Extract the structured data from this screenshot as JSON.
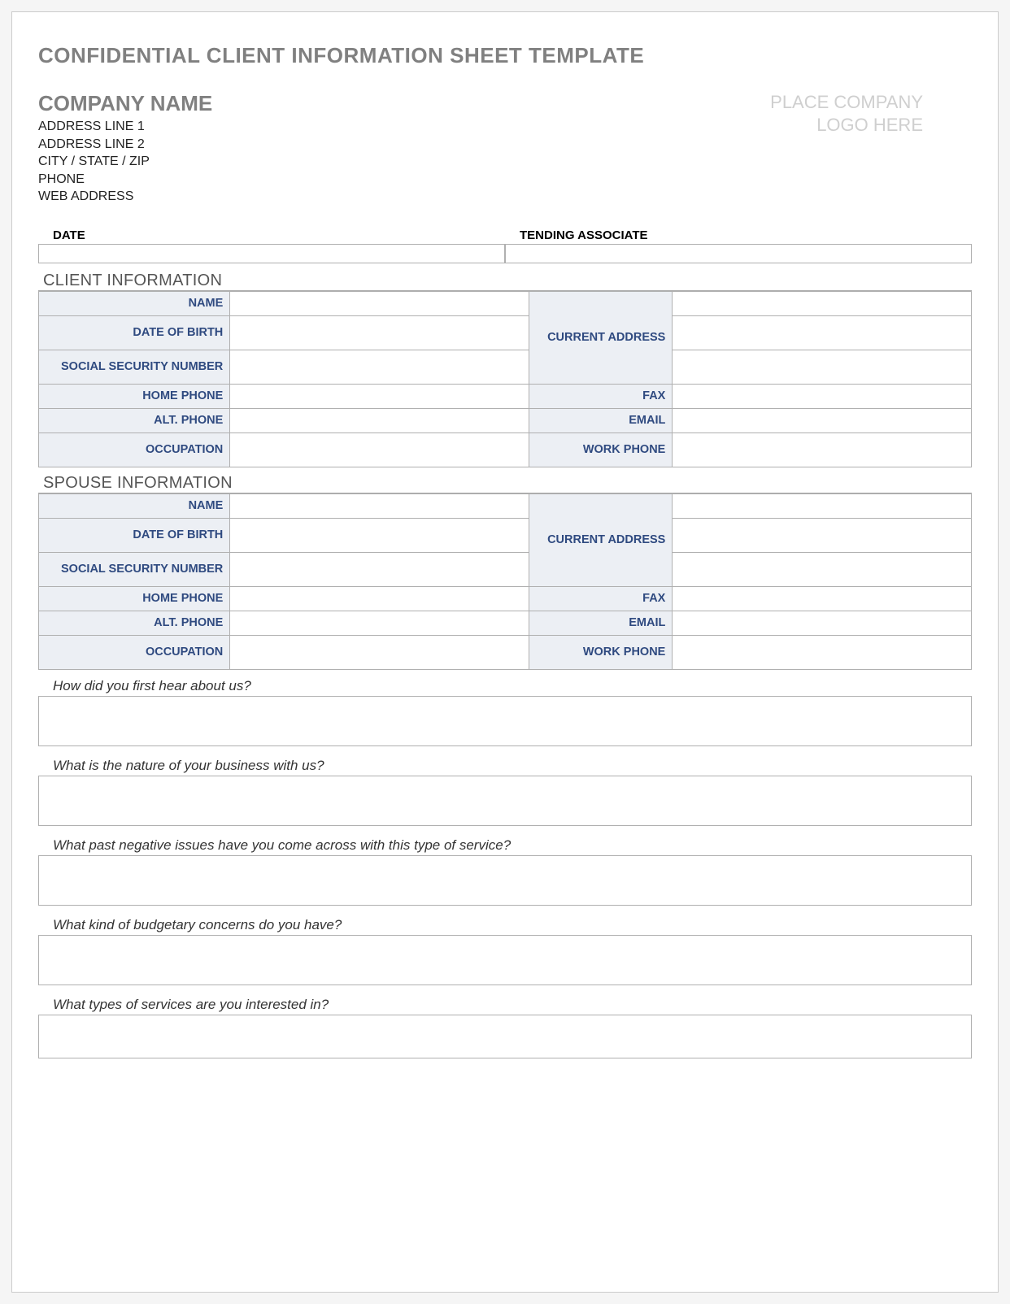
{
  "doc_title": "CONFIDENTIAL CLIENT INFORMATION SHEET TEMPLATE",
  "company": {
    "name": "COMPANY NAME",
    "addr1": "ADDRESS LINE 1",
    "addr2": "ADDRESS LINE 2",
    "city_state_zip": "CITY / STATE / ZIP",
    "phone": "PHONE",
    "web": "WEB ADDRESS"
  },
  "logo_placeholder": {
    "line1": "PLACE COMPANY",
    "line2": "LOGO HERE"
  },
  "top_fields": {
    "date_label": "DATE",
    "associate_label": "TENDING ASSOCIATE"
  },
  "sections": {
    "client_title": "CLIENT INFORMATION",
    "spouse_title": "SPOUSE INFORMATION"
  },
  "labels": {
    "name": "NAME",
    "dob": "DATE OF BIRTH",
    "ssn": "SOCIAL SECURITY NUMBER",
    "home_phone": "HOME PHONE",
    "alt_phone": "ALT. PHONE",
    "occupation": "OCCUPATION",
    "current_address": "CURRENT ADDRESS",
    "fax": "FAX",
    "email": "EMAIL",
    "work_phone": "WORK PHONE"
  },
  "questions": {
    "q1": "How did you first hear about us?",
    "q2": "What is the nature of your business with us?",
    "q3": "What past negative issues have you come across with this type of service?",
    "q4": "What kind of budgetary concerns do you have?",
    "q5": "What types of services are you interested in?"
  }
}
